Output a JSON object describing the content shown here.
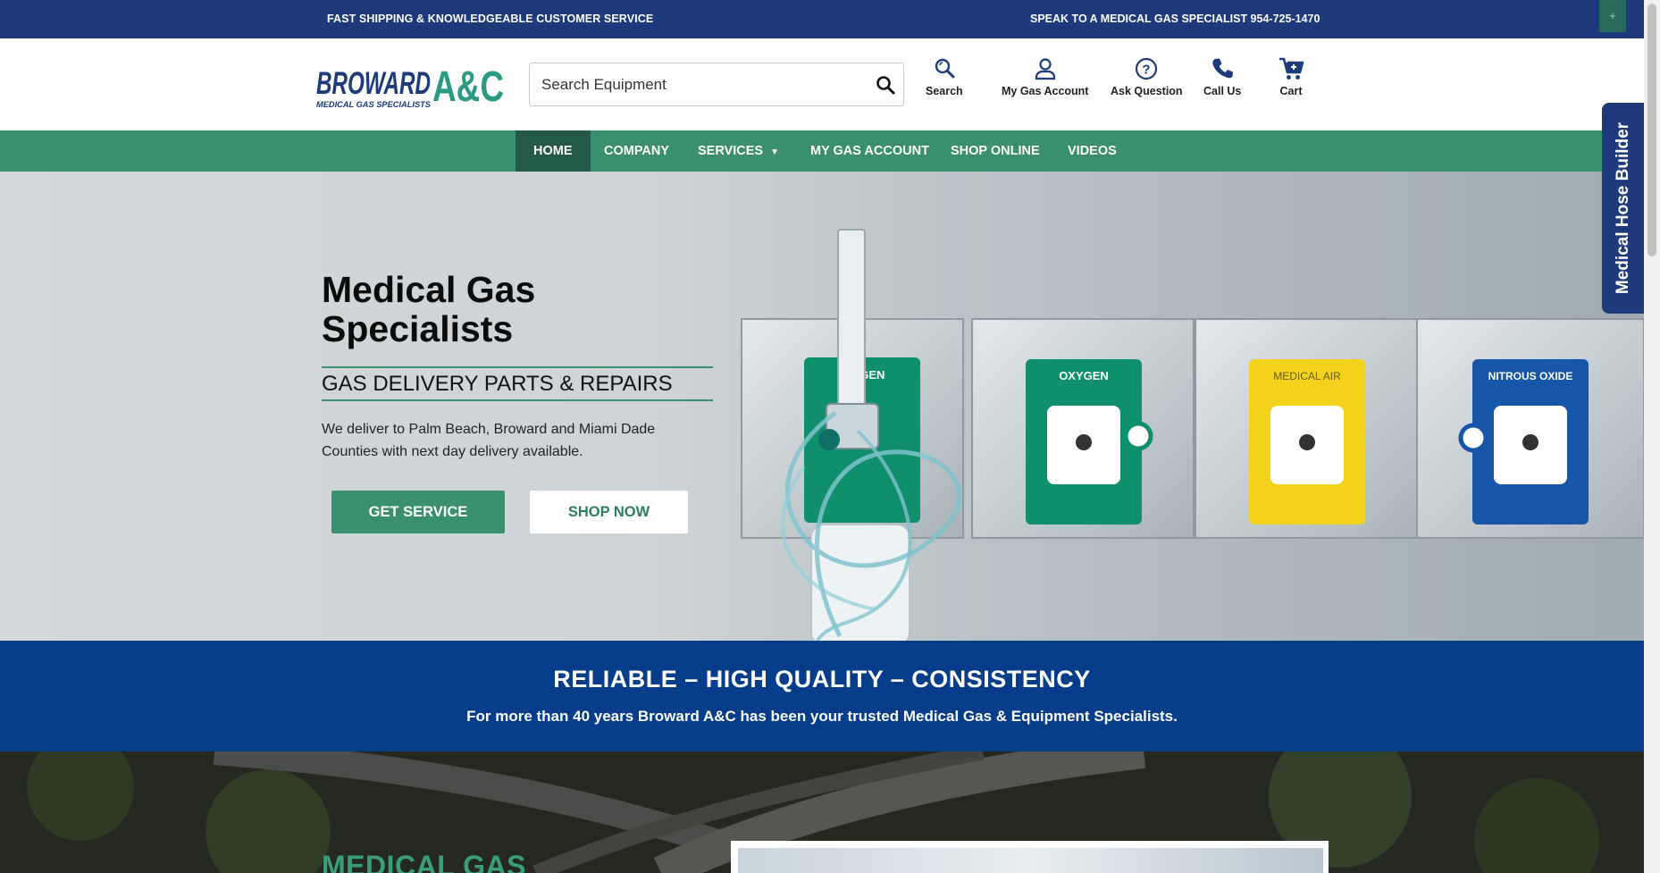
{
  "topbar": {
    "left_text": "FAST SHIPPING & KNOWLEDGEABLE CUSTOMER SERVICE",
    "right_text": "SPEAK TO A MEDICAL GAS SPECIALIST 954-725-1470",
    "corner_button": "+"
  },
  "header": {
    "logo_main": "BROWARD",
    "logo_accent": "A&C",
    "logo_tagline": "MEDICAL GAS SPECIALISTS",
    "search_placeholder": "Search Equipment",
    "items": [
      {
        "label": "Search",
        "icon": "search-icon"
      },
      {
        "label": "My Gas Account",
        "icon": "user-icon"
      },
      {
        "label": "Ask Question",
        "icon": "question-icon"
      },
      {
        "label": "Call Us",
        "icon": "phone-icon"
      },
      {
        "label": "Cart",
        "icon": "cart-icon"
      }
    ]
  },
  "nav": {
    "items": [
      "HOME",
      "COMPANY",
      "SERVICES",
      "MY GAS ACCOUNT",
      "SHOP ONLINE",
      "VIDEOS"
    ],
    "active": "HOME"
  },
  "hero": {
    "title": "Medical Gas Specialists",
    "subtitle": "GAS DELIVERY PARTS & REPAIRS",
    "text": "We deliver to Palm Beach, Broward and Miami Dade Counties with next day delivery available.",
    "primary_button": "GET SERVICE",
    "secondary_button": "SHOP NOW",
    "outlets": [
      {
        "label": "YGEN",
        "color": "#0f8f6c"
      },
      {
        "label": "OXYGEN",
        "color": "#0f8f6c"
      },
      {
        "label": "MEDICAL AIR",
        "color": "#f2d21a"
      },
      {
        "label": "NITROUS OXIDE",
        "color": "#1656a8"
      }
    ]
  },
  "side_tab": {
    "label": "Medical Hose Builder"
  },
  "band": {
    "heading": "RELIABLE – HIGH QUALITY – CONSISTENCY",
    "text": "For more than 40 years Broward A&C has been your trusted Medical Gas & Equipment Specialists."
  },
  "bottom": {
    "title": "MEDICAL GAS"
  },
  "colors": {
    "navy": "#1d3a7a",
    "green": "#3a8f6e",
    "green_dark": "#24594a",
    "band_blue": "#063d8a"
  }
}
